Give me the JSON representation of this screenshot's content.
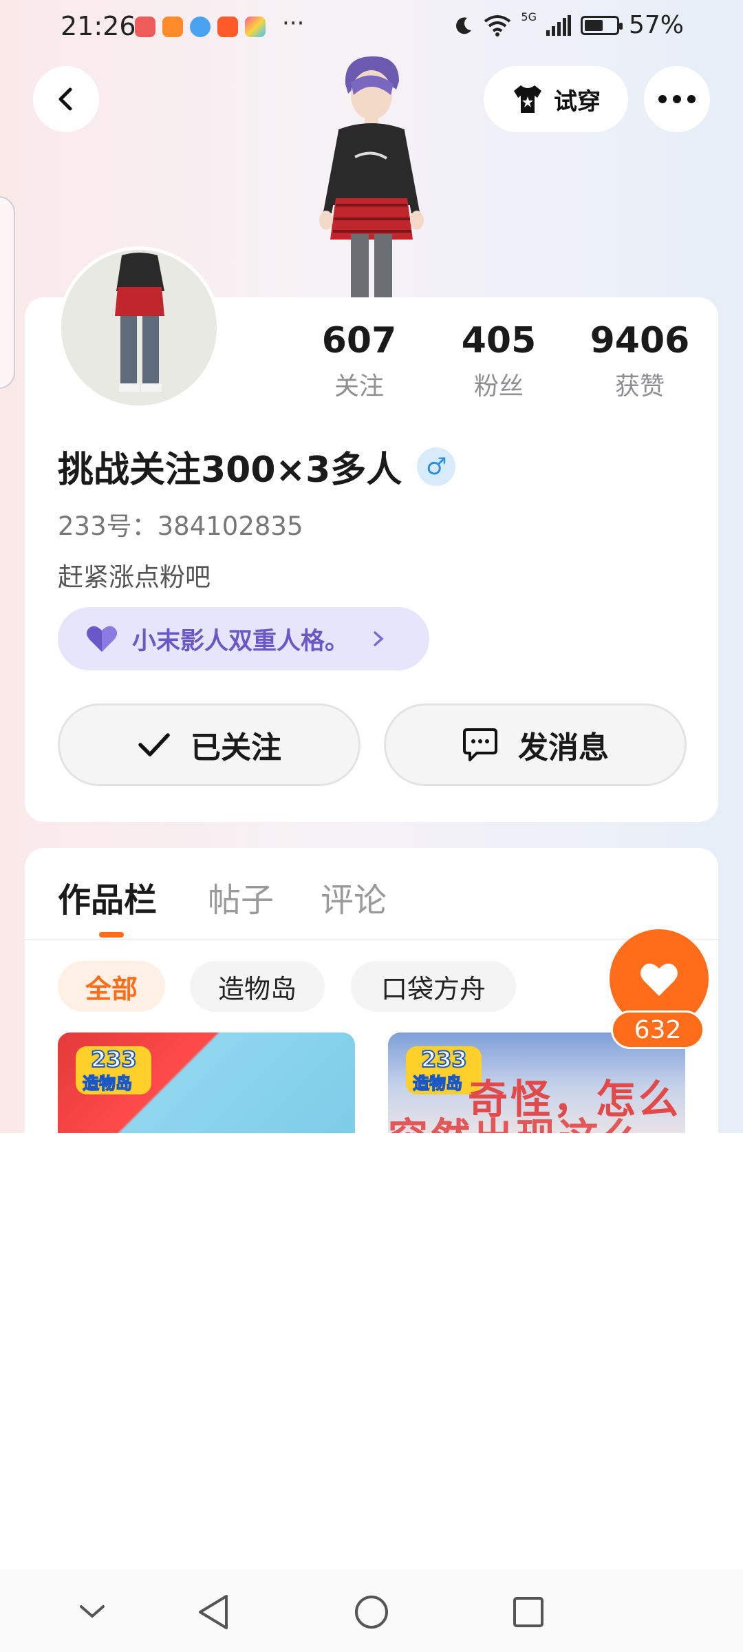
{
  "status_bar": {
    "time": "21:26",
    "more_indicator": "···",
    "network": "5G",
    "battery": "57%"
  },
  "header": {
    "try_on_label": "试穿"
  },
  "profile": {
    "stats": [
      {
        "value": "607",
        "label": "关注"
      },
      {
        "value": "405",
        "label": "粉丝"
      },
      {
        "value": "9406",
        "label": "获赞"
      }
    ],
    "username": "挑战关注300×3多人",
    "gender_symbol": "♂",
    "uid": "233号：384102835",
    "bio": "赶紧涨点粉吧",
    "persona_text": "小末影人双重人格。",
    "followed_label": "已关注",
    "message_label": "发消息"
  },
  "works": {
    "tabs": [
      "作品栏",
      "帖子",
      "评论"
    ],
    "filters": [
      "全部",
      "造物岛",
      "口袋方舟"
    ],
    "thumb_logo_text": "233",
    "thumb_logo_sub": "造物岛",
    "thumb2_caption_1": "奇怪，怎么",
    "thumb2_caption_2": "突然出现这么"
  },
  "like": {
    "count": "632"
  },
  "colors": {
    "accent": "#ff6d1a",
    "persona_bg": "#e6e5fb",
    "persona_text": "#6a58c8",
    "gender_blue": "#2d8fe0"
  },
  "icons": {
    "back": "chevron-left-icon",
    "try_on": "shirt-icon",
    "more": "more-dots-icon",
    "persona": "heart-icon",
    "followed": "check-icon",
    "message": "chat-bubble-icon",
    "like": "heart-icon"
  }
}
